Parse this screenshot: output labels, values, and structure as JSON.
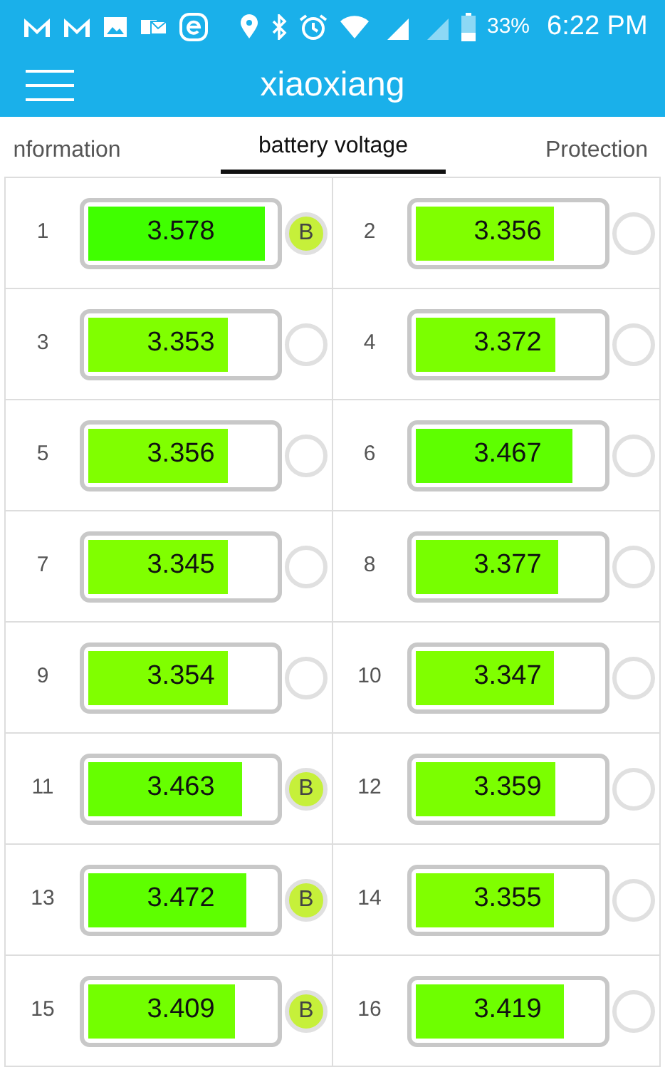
{
  "status_bar": {
    "battery_percent": "33%",
    "time": "6:22 PM"
  },
  "app_bar": {
    "title": "xiaoxiang"
  },
  "tabs": [
    {
      "label": "nformation",
      "selected": false
    },
    {
      "label": "battery voltage",
      "selected": true
    },
    {
      "label": "Protection",
      "selected": false
    }
  ],
  "cells": [
    {
      "number": "1",
      "voltage": "3.578",
      "level": 0.95,
      "balancing": true,
      "badge": "B"
    },
    {
      "number": "2",
      "voltage": "3.356",
      "level": 0.75,
      "balancing": false
    },
    {
      "number": "3",
      "voltage": "3.353",
      "level": 0.75,
      "balancing": false
    },
    {
      "number": "4",
      "voltage": "3.372",
      "level": 0.76,
      "balancing": false
    },
    {
      "number": "5",
      "voltage": "3.356",
      "level": 0.75,
      "balancing": false
    },
    {
      "number": "6",
      "voltage": "3.467",
      "level": 0.85,
      "balancing": false
    },
    {
      "number": "7",
      "voltage": "3.345",
      "level": 0.75,
      "balancing": false
    },
    {
      "number": "8",
      "voltage": "3.377",
      "level": 0.77,
      "balancing": false
    },
    {
      "number": "9",
      "voltage": "3.354",
      "level": 0.75,
      "balancing": false
    },
    {
      "number": "10",
      "voltage": "3.347",
      "level": 0.75,
      "balancing": false
    },
    {
      "number": "11",
      "voltage": "3.463",
      "level": 0.83,
      "balancing": true,
      "badge": "B"
    },
    {
      "number": "12",
      "voltage": "3.359",
      "level": 0.76,
      "balancing": false
    },
    {
      "number": "13",
      "voltage": "3.472",
      "level": 0.85,
      "balancing": true,
      "badge": "B"
    },
    {
      "number": "14",
      "voltage": "3.355",
      "level": 0.75,
      "balancing": false
    },
    {
      "number": "15",
      "voltage": "3.409",
      "level": 0.79,
      "balancing": true,
      "badge": "B"
    },
    {
      "number": "16",
      "voltage": "3.419",
      "level": 0.8,
      "balancing": false
    }
  ]
}
